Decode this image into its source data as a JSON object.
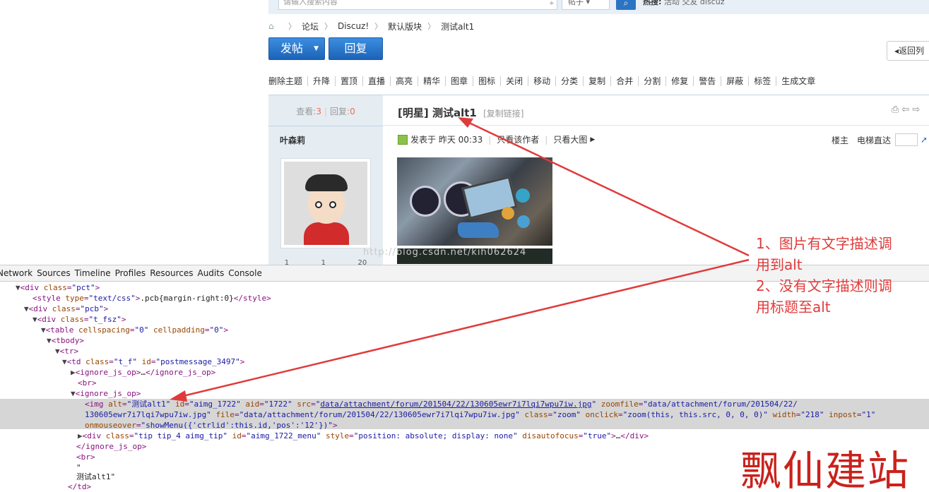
{
  "search": {
    "placeholder": "请输入搜索内容",
    "type": "帖子",
    "hot_label": "热搜:",
    "hot_words": "活动 交友 discuz"
  },
  "breadcrumb": [
    "论坛",
    "Discuz!",
    "默认版块",
    "测试alt1"
  ],
  "buttons": {
    "post": "发帖",
    "reply": "回复",
    "back": "返回列"
  },
  "mod_actions": [
    "删除主题",
    "升降",
    "置顶",
    "直播",
    "高亮",
    "精华",
    "图章",
    "图标",
    "关闭",
    "移动",
    "分类",
    "复制",
    "合并",
    "分割",
    "修复",
    "警告",
    "屏蔽",
    "标签",
    "生成文章"
  ],
  "stats": {
    "views_label": "查看:",
    "views": "3",
    "replies_label": "回复:",
    "replies": "0"
  },
  "author": "叶森莉",
  "author_counts": [
    "1",
    "1",
    "20"
  ],
  "post": {
    "title_prefix": "[明星]",
    "title": "测试alt1",
    "copy_link": "[复制链接]",
    "posted": "发表于 昨天 00:33",
    "only_author": "只看该作者",
    "only_big": "只看大图",
    "floor": "楼主",
    "jump": "电梯直达"
  },
  "watermark": "http://blog.csdn.net/kih062624",
  "devtools": {
    "tabs": [
      "Network",
      "Sources",
      "Timeline",
      "Profiles",
      "Resources",
      "Audits",
      "Console"
    ]
  },
  "annotation": {
    "line1": "1、图片有文字描述调",
    "line2": "用到alt",
    "line3": "2、没有文字描述则调",
    "line4": "用标题至alt"
  },
  "brand": "飘仙建站",
  "colors": {
    "accent": "#1c63b8",
    "annotation": "#e03b3b",
    "brand": "#c9221b"
  }
}
